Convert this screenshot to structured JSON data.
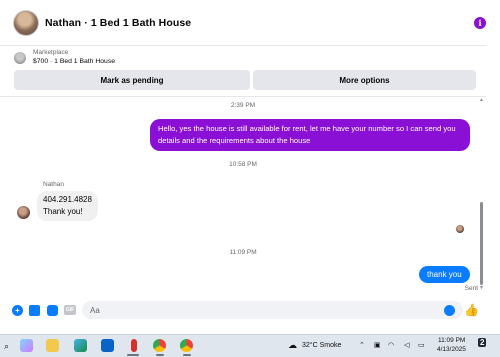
{
  "header": {
    "title": "Nathan · 1 Bed 1 Bath House",
    "info_icon": "info-icon"
  },
  "marketplace": {
    "label": "Marketplace",
    "item": "$700 · 1 Bed 1 Bath House"
  },
  "actions": {
    "pending": "Mark as pending",
    "more": "More options"
  },
  "messages": {
    "t1": "2:39 PM",
    "outgoing1": "Hello, yes the house is still available for rent, let me have your number so I can send you details and the requirements about the house",
    "t2": "10:58 PM",
    "sender": "Nathan",
    "incoming_line1": "404.291.4828",
    "incoming_line2": "Thank you!",
    "t3": "11:09 PM",
    "outgoing2": "thank you",
    "status": "Sent"
  },
  "composer": {
    "placeholder": "Aa",
    "gif_label": "GIF"
  },
  "taskbar": {
    "weather": "32°C  Smoke",
    "time": "11:09 PM",
    "date": "4/13/2025",
    "notification_count": "2"
  },
  "colors": {
    "outgoing": "#8a10d6",
    "accent": "#0a7cff"
  }
}
